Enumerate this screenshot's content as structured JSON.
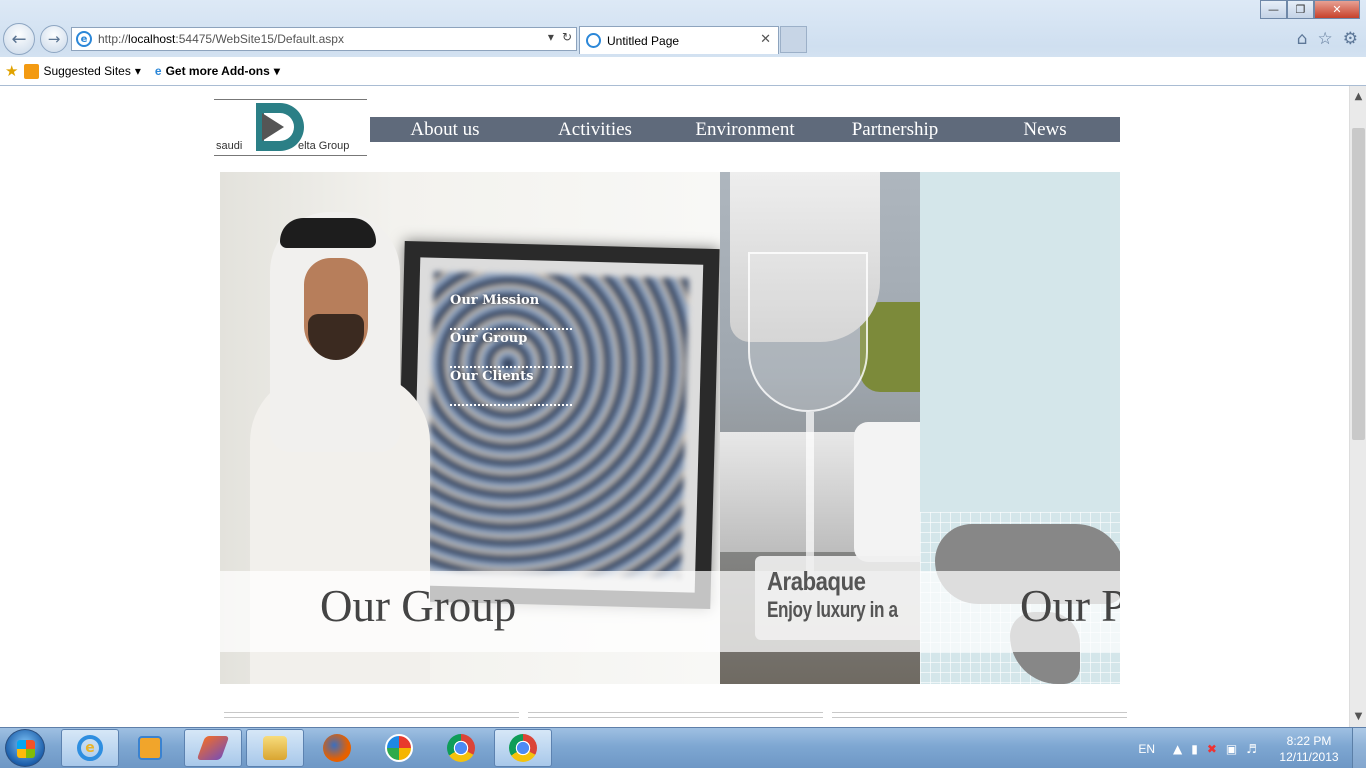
{
  "browser": {
    "url_prefix": "http://",
    "url_host": "localhost",
    "url_rest": ":54475/WebSite15/Default.aspx",
    "tab_title": "Untitled Page",
    "favorites": [
      {
        "label": "Suggested Sites"
      },
      {
        "label": "Get more Add-ons"
      }
    ]
  },
  "logo": {
    "left_text": "saudi",
    "right_text": "elta Group"
  },
  "nav": {
    "items": [
      "About us",
      "Activities",
      "Environment",
      "Partnership",
      "News"
    ]
  },
  "slider": {
    "submenu": [
      "Our Mission",
      "Our Group",
      "Our Clients"
    ],
    "slide1_caption": "Our Group",
    "slide2_title": "Arabaque",
    "slide2_subtitle": "Enjoy luxury in a",
    "slide3_caption": "Our P"
  },
  "taskbar": {
    "language": "EN",
    "time": "8:22 PM",
    "date": "12/11/2013"
  },
  "colors": {
    "nav_bg": "#5f6a7b",
    "logo_teal": "#2b7f86",
    "slide3_bg": "#d4e6ea"
  }
}
